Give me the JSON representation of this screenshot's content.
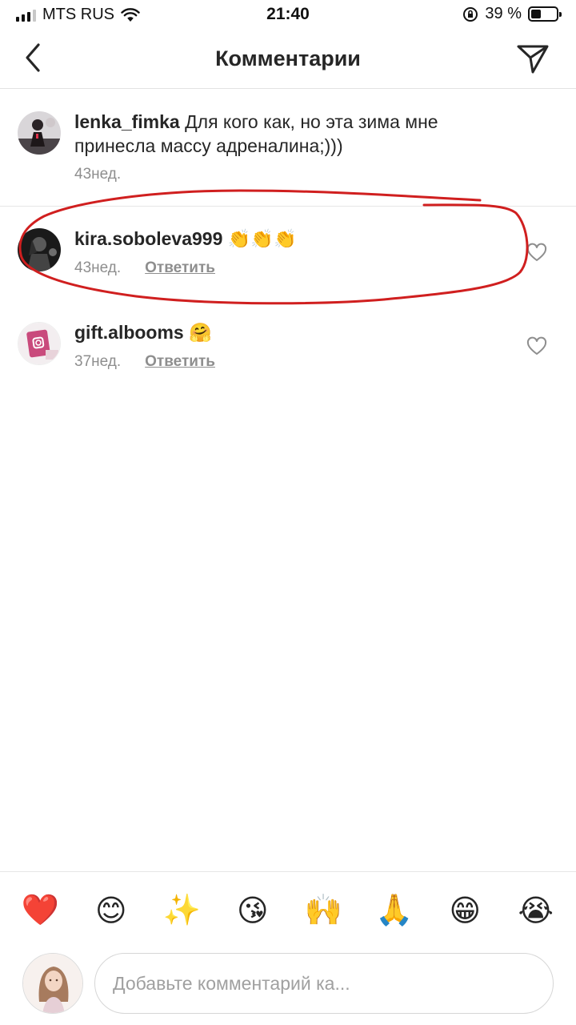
{
  "status_bar": {
    "carrier": "MTS RUS",
    "time": "21:40",
    "battery_percent": "39 %",
    "battery_level": 0.39
  },
  "header": {
    "title": "Комментарии",
    "back_icon": "chevron-left-icon",
    "send_icon": "paper-plane-icon"
  },
  "comments": [
    {
      "username": "lenka_fimka",
      "text": "Для кого как, но эта зима мне принесла массу адреналина;)))",
      "time": "43нед.",
      "reply_label": "",
      "liked": false
    },
    {
      "username": "kira.soboleva999",
      "text": "👏👏👏",
      "time": "43нед.",
      "reply_label": "Ответить",
      "liked": false
    },
    {
      "username": "gift.albooms",
      "text": "🤗",
      "time": "37нед.",
      "reply_label": "Ответить",
      "liked": false
    }
  ],
  "emoji_bar": [
    "❤️",
    "😊",
    "✨",
    "😘",
    "🙌",
    "🙏",
    "😁",
    "😭"
  ],
  "input": {
    "placeholder": "Добавьте комментарий ка..."
  },
  "colors": {
    "text": "#262626",
    "muted": "#8e8e8e",
    "annotation": "#d01f1f"
  }
}
